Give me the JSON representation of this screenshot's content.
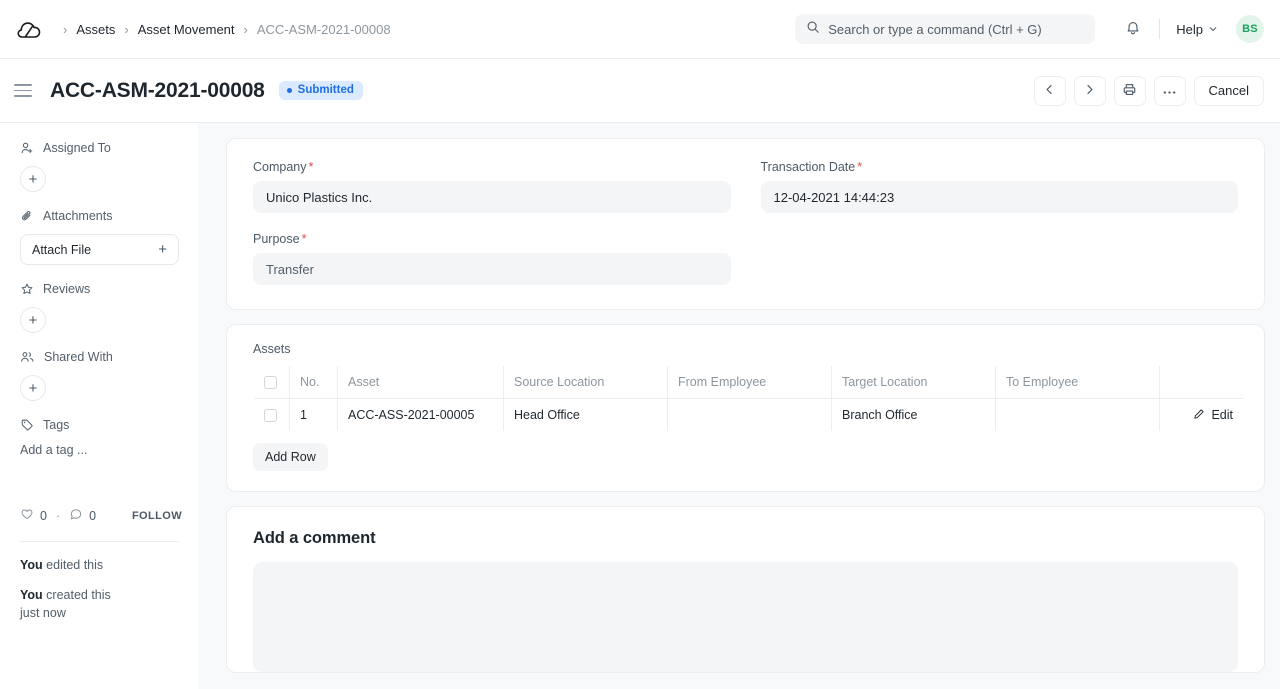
{
  "navbar": {
    "logo_icon": "frappe-cloud-logo",
    "breadcrumb": [
      {
        "label": "Assets",
        "current": false
      },
      {
        "label": "Asset Movement",
        "current": false
      },
      {
        "label": "ACC-ASM-2021-00008",
        "current": true
      }
    ],
    "separator": "›",
    "search": {
      "icon": "search-icon",
      "placeholder": "Search or type a command (Ctrl + G)",
      "value": ""
    },
    "notifications_icon": "bell-icon",
    "help_label": "Help",
    "help_chevron_icon": "chevron-down-icon",
    "avatar_initials": "BS",
    "avatar_bg": "#e3f5ea",
    "avatar_color": "#1aa260"
  },
  "pagehead": {
    "menu_icon": "hamburger-menu-icon",
    "title": "ACC-ASM-2021-00008",
    "status": {
      "label": "Submitted",
      "color": "#1f6fe0",
      "bg": "#dbeafe"
    },
    "actions": {
      "prev_icon": "chevron-left-icon",
      "next_icon": "chevron-right-icon",
      "print_icon": "printer-icon",
      "more_icon": "ellipsis-icon",
      "cancel_label": "Cancel"
    }
  },
  "sidebar": {
    "sections": [
      {
        "icon": "assigned-user-icon",
        "label": "Assigned To",
        "control": "plus-circle"
      },
      {
        "icon": "paperclip-icon",
        "label": "Attachments",
        "control": "attach-file",
        "attach_label": "Attach File"
      },
      {
        "icon": "star-icon",
        "label": "Reviews",
        "control": "plus-circle"
      },
      {
        "icon": "shared-users-icon",
        "label": "Shared With",
        "control": "plus-circle"
      },
      {
        "icon": "tag-icon",
        "label": "Tags",
        "control": "add-tag",
        "add_tag_label": "Add a tag ..."
      }
    ],
    "stats": {
      "like_icon": "heart-icon",
      "like_count": "0",
      "separator": "·",
      "comment_icon": "comment-icon",
      "comment_count": "0",
      "follow_label": "FOLLOW"
    },
    "activity": [
      {
        "actor": "You",
        "text": " edited this",
        "time": ""
      },
      {
        "actor": "You",
        "text": " created this",
        "time": "just now"
      }
    ]
  },
  "form": {
    "fields": [
      {
        "label": "Company",
        "required": true,
        "value": "Unico Plastics Inc.",
        "muted": false
      },
      {
        "label": "Transaction Date",
        "required": true,
        "value": "12-04-2021 14:44:23",
        "muted": false
      },
      {
        "label": "Purpose",
        "required": true,
        "value": "Transfer",
        "muted": true
      }
    ],
    "required_mark": "*"
  },
  "assets_grid": {
    "title": "Assets",
    "columns": [
      "",
      "No.",
      "Asset",
      "Source Location",
      "From Employee",
      "Target Location",
      "To Employee",
      ""
    ],
    "rows": [
      {
        "no": "1",
        "asset": "ACC-ASS-2021-00005",
        "source_location": "Head Office",
        "from_employee": "",
        "target_location": "Branch Office",
        "to_employee": "",
        "edit_label": "Edit",
        "edit_icon": "pencil-icon"
      }
    ],
    "add_row_label": "Add Row"
  },
  "comment": {
    "title": "Add a comment",
    "placeholder": ""
  }
}
